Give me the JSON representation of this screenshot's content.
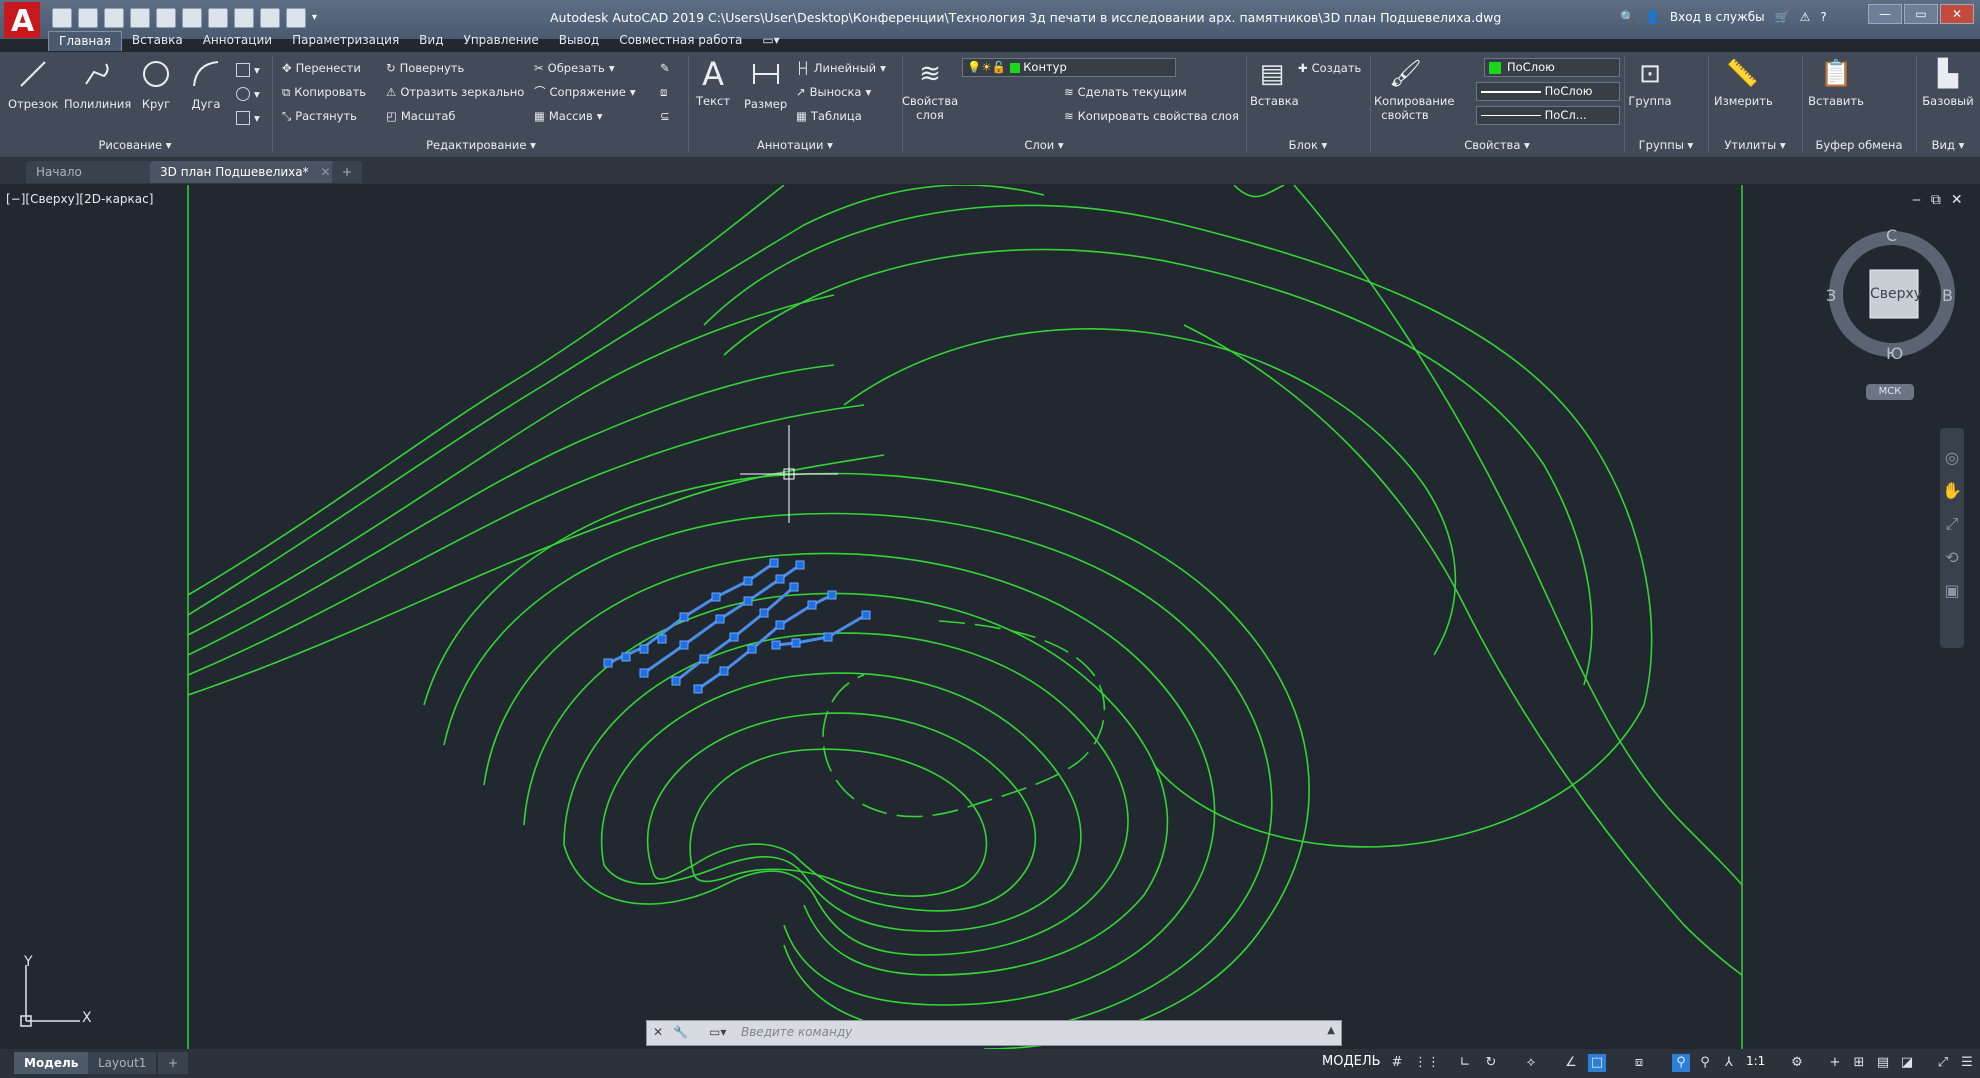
{
  "window": {
    "title": "Autodesk AutoCAD 2019   C:\\Users\\User\\Desktop\\Конференции\\Технология 3д печати в исследовании арх. памятников\\3D план Подшевелиха.dwg",
    "signin": "Вход в службы",
    "controls": [
      "—",
      "▭",
      "✕"
    ]
  },
  "ribbon_tabs": [
    "Главная",
    "Вставка",
    "Аннотации",
    "Параметризация",
    "Вид",
    "Управление",
    "Вывод",
    "Совместная работа"
  ],
  "ribbon": {
    "draw": {
      "title": "Рисование ▾",
      "line": "Отрезок",
      "polyline": "Полилиния",
      "circle": "Круг",
      "arc": "Дуга"
    },
    "modify": {
      "title": "Редактирование ▾",
      "move": "Перенести",
      "rotate": "Повернуть",
      "trim": "Обрезать",
      "copy": "Копировать",
      "mirror": "Отразить зеркально",
      "fillet": "Сопряжение",
      "stretch": "Растянуть",
      "scale": "Масштаб",
      "array": "Массив"
    },
    "annotation": {
      "title": "Аннотации ▾",
      "text": "Текст",
      "dimension": "Размер",
      "linear": "Линейный",
      "leader": "Выноска",
      "table": "Таблица"
    },
    "layers": {
      "title": "Слои ▾",
      "properties": "Свойства слоя",
      "current_layer": "Контур",
      "make_current": "Сделать текущим",
      "match_layer": "Копировать свойства слоя"
    },
    "block": {
      "title": "Блок ▾",
      "insert": "Вставка",
      "create": "Создать"
    },
    "properties": {
      "title": "Свойства ▾",
      "match": "Копирование свойств",
      "color": "ПоСлою",
      "lineweight": "ПоСлою",
      "linetype": "ПоСл..."
    },
    "groups": {
      "title": "Группы ▾",
      "group": "Группа"
    },
    "utilities": {
      "title": "Утилиты ▾",
      "measure": "Измерить"
    },
    "clipboard": {
      "title": "Буфер обмена",
      "paste": "Вставить"
    },
    "view": {
      "title": "Вид ▾",
      "base": "Базовый"
    }
  },
  "doc_tabs": [
    "Начало",
    "3D план Подшевелиха*"
  ],
  "viewport": {
    "label": "[−][Сверху][2D-каркас]",
    "viewcube": {
      "n": "С",
      "s": "Ю",
      "e": "В",
      "w": "З",
      "face": "Сверху",
      "ucs": "МСК"
    },
    "axis_x": "X",
    "axis_y": "Y"
  },
  "command": {
    "placeholder": "Введите команду"
  },
  "layout_tabs": [
    "Модель",
    "Layout1"
  ],
  "status": {
    "model": "МОДЕЛЬ",
    "scale": "1:1"
  },
  "colors": {
    "contour": "#35d435",
    "grips": "#1f6fe0",
    "background": "#212830"
  }
}
